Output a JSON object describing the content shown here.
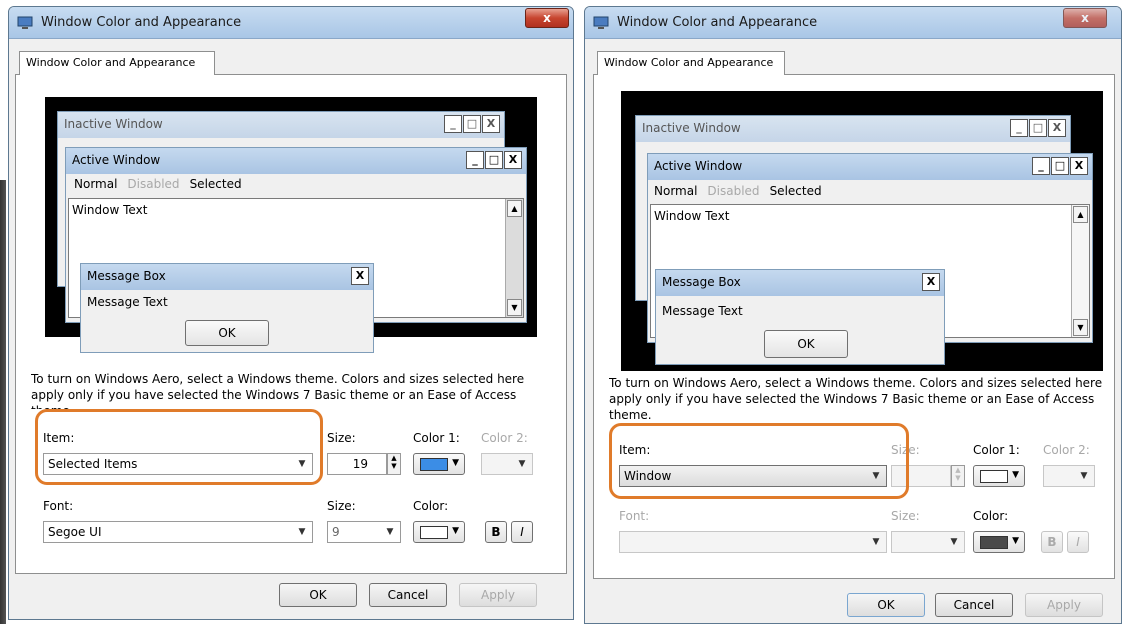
{
  "dialog": {
    "title": "Window Color and Appearance",
    "close_symbol": "x",
    "tab_label": "Window Color and Appearance"
  },
  "preview": {
    "inactive_window_title": "Inactive Window",
    "active_window_title": "Active Window",
    "menu_normal": "Normal",
    "menu_disabled": "Disabled",
    "menu_selected": "Selected",
    "window_text": "Window Text",
    "message_box_title": "Message Box",
    "message_text": "Message Text",
    "ok_label": "OK",
    "minimize_symbol": "_",
    "maximize_symbol": "□",
    "close_symbol": "X"
  },
  "instructions": "To turn on Windows Aero, select a Windows theme.  Colors and sizes selected here apply only if you have selected the Windows 7 Basic theme or an Ease of Access theme.",
  "labels": {
    "item": "Item:",
    "size": "Size:",
    "color1": "Color 1:",
    "color2": "Color 2:",
    "font": "Font:",
    "font_size": "Size:",
    "font_color": "Color:"
  },
  "left": {
    "item_value": "Selected Items",
    "size_value": "19",
    "color1_hex": "#3b8de6",
    "font_value": "Segoe UI",
    "font_size_value": "9",
    "font_color_hex": "#ffffff"
  },
  "right": {
    "item_value": "Window",
    "color1_hex": "#ffffff",
    "font_color_hex": "#4a4a4a"
  },
  "buttons": {
    "bold": "B",
    "italic": "I",
    "ok": "OK",
    "cancel": "Cancel",
    "apply": "Apply"
  },
  "colors": {
    "highlight": "#e07b2a",
    "selection_blue": "#3b8de6"
  }
}
